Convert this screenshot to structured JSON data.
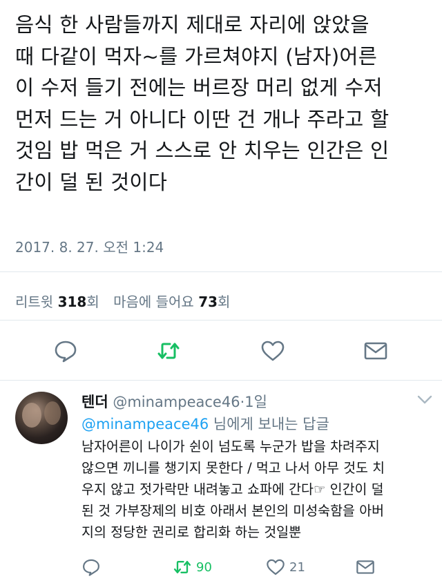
{
  "tweet": {
    "text": "음식 한 사람들까지 제대로 자리에 앉았을\n때 다같이 먹자~를 가르쳐야지 (남자)어른\n이 수저 들기 전에는 버르장 머리 없게 수저\n먼저 드는 거 아니다 이딴 건 개나 주라고 할\n것임 밥 먹은 거 스스로 안 치우는 인간은 인\n간이 덜 된 것이다",
    "timestamp": "2017. 8. 27. 오전 1:24",
    "retweets_label": "리트윗",
    "retweets_count": "318",
    "retweets_unit": "회",
    "likes_label": "마음에 들어요",
    "likes_count": "73",
    "likes_unit": "회"
  },
  "icons": {
    "reply": "reply-icon",
    "retweet": "retweet-icon",
    "like": "heart-icon",
    "message": "envelope-icon",
    "more": "chevron-down-icon"
  },
  "colors": {
    "retweet": "#17bf63",
    "link": "#1da1f2",
    "muted": "#657786"
  },
  "reply": {
    "name": "텐더",
    "handle": "@minampeace46",
    "time_sep": "·",
    "time": "1일",
    "replying_handle": "@minampeace46",
    "replying_suffix": " 님에게 보내는 답글",
    "text": "남자어른이 나이가 쉰이 넘도록 누군가 밥을 차려주지\n않으면 끼니를 챙기지 못한다 / 먹고 나서 아무 것도 치\n우지 않고 젓가락만 내려놓고 쇼파에 간다☞ 인간이 덜\n된 것 가부장제의 비호 아래서 본인의 미성숙함을 아버\n지의 정당한 권리로 합리화 하는 것일뿐",
    "retweet_count": "90",
    "like_count": "21"
  }
}
